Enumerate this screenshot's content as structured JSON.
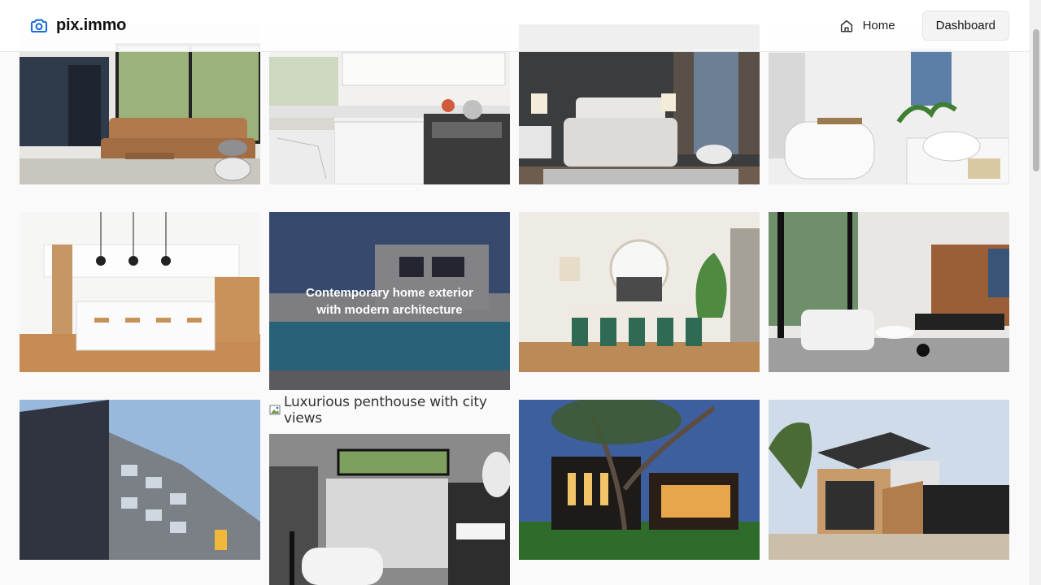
{
  "header": {
    "brand": {
      "name": "pix.immo",
      "icon": "camera-icon",
      "accent": "#1d6ddb"
    },
    "nav": {
      "home_label": "Home",
      "home_icon": "home-icon",
      "dashboard_label": "Dashboard"
    }
  },
  "gallery": {
    "hover_caption": "Contemporary home exterior with modern architecture",
    "broken_image_alt": "Luxurious penthouse with city views",
    "tiles": [
      {
        "scene": "living-room"
      },
      {
        "scene": "kitchen"
      },
      {
        "scene": "bedroom"
      },
      {
        "scene": "bathroom"
      },
      {
        "scene": "kitchen-island"
      },
      {
        "scene": "exterior-pool"
      },
      {
        "scene": "dining-room"
      },
      {
        "scene": "open-living"
      },
      {
        "scene": "apartment-building"
      },
      {
        "scene": "shower-bathroom"
      },
      {
        "scene": "house-night"
      },
      {
        "scene": "house-wood-facade"
      }
    ]
  },
  "colors": {
    "background": "#fafafa",
    "border": "#e4e4e7",
    "button_bg": "#f4f4f5",
    "brand_blue": "#1d6ddb"
  }
}
